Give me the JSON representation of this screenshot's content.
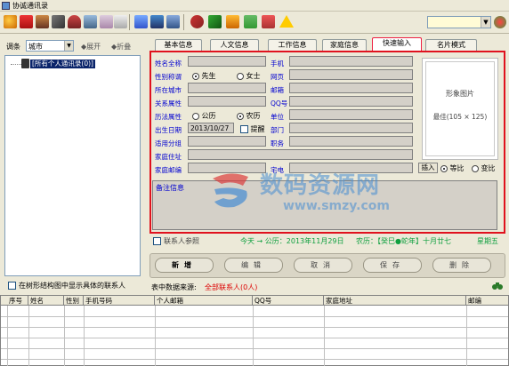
{
  "window": {
    "title": "协诚通讯录"
  },
  "toolbar": {
    "combo_value": ""
  },
  "leftpanel": {
    "group_label": "调条",
    "group_select": "城市",
    "expand_label": "◆展开",
    "collapse_label": "◆折叠",
    "tree_root": "[所有个人通讯录(0)]",
    "show_checkbox_label": "在树形结构图中显示具体的联系人"
  },
  "tabs": [
    {
      "label": "基本信息"
    },
    {
      "label": "人文信息"
    },
    {
      "label": "工作信息"
    },
    {
      "label": "家庭信息"
    },
    {
      "label": "快速输入",
      "active": true
    },
    {
      "label": "名片模式"
    }
  ],
  "form": {
    "name_label": "姓名全称",
    "sex_label": "性别称谓",
    "sex_options": [
      "先生",
      "女士"
    ],
    "city_label": "所在城市",
    "relation_label": "关系属性",
    "calendar_label": "历法属性",
    "calendar_options": [
      "公历",
      "农历"
    ],
    "birthday_label": "出生日期",
    "birthday_value": "2013/10/27",
    "remind_label": "提醒",
    "group_label": "适用分组",
    "home_address_label": "家庭住址",
    "home_zip_label": "家庭邮编",
    "mobile_label": "手机",
    "web_label": "网页",
    "email_label": "邮箱",
    "qq_label": "QQ号",
    "company_label": "单位",
    "dept_label": "部门",
    "job_label": "职务",
    "home_phone_label": "宅电",
    "memo_label": "备注信息"
  },
  "photo": {
    "title": "形象图片",
    "size": "最佳(105 × 125)",
    "insert_label": "插入",
    "fit_options": [
      "等比",
      "变比"
    ]
  },
  "datebar": {
    "contact_checkbox_label": "联系人参照",
    "today": "今天 → 公历：2013年11月29日",
    "lunar": "农历：【癸巳●蛇年】十月廿七",
    "weekday": "星期五"
  },
  "actions": {
    "add": "新增",
    "edit": "编辑",
    "cancel": "取消",
    "save": "保存",
    "delete": "删除"
  },
  "source": {
    "label": "表中数据来源:",
    "value": "全部联系人(0人)"
  },
  "grid": {
    "columns": [
      "序号",
      "姓名",
      "性别",
      "手机号码",
      "个人邮箱",
      "QQ号",
      "家庭地址",
      "邮编"
    ]
  },
  "watermark": {
    "text": "数码资源网",
    "url": "www.smzy.com"
  }
}
